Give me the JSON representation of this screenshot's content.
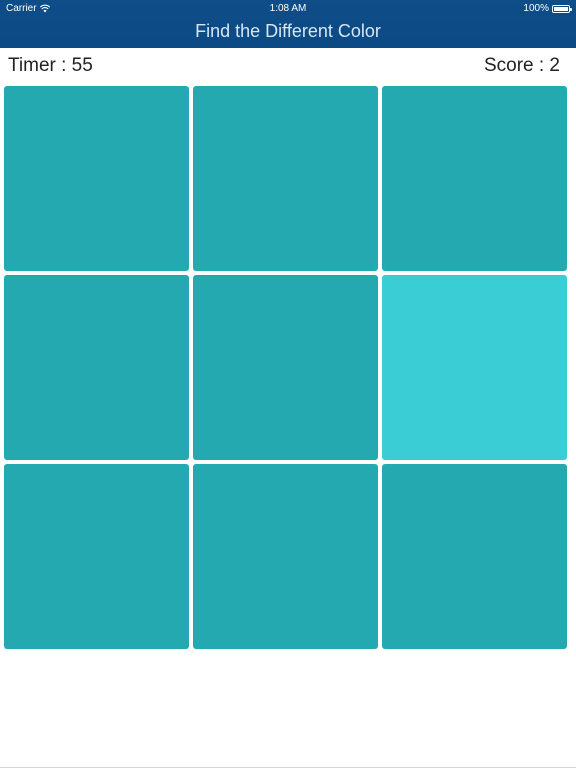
{
  "status_bar": {
    "carrier": "Carrier",
    "time": "1:08 AM",
    "battery_text": "100%",
    "battery_level": 1.0
  },
  "header": {
    "title": "Find the Different Color"
  },
  "hud": {
    "timer": "Timer : 55",
    "score": "Score : 2"
  },
  "grid": {
    "rows": 3,
    "cols": 3,
    "base_color": "#24a9b0",
    "odd_color": "#3acdd6",
    "tiles": [
      {
        "color": "#24a9b0"
      },
      {
        "color": "#24a9b0"
      },
      {
        "color": "#24a9b0"
      },
      {
        "color": "#24a9b0"
      },
      {
        "color": "#24a9b0"
      },
      {
        "color": "#3acdd6"
      },
      {
        "color": "#24a9b0"
      },
      {
        "color": "#24a9b0"
      },
      {
        "color": "#24a9b0"
      }
    ]
  },
  "colors": {
    "nav_bar": "#0b4a85",
    "background": "#ffffff"
  }
}
